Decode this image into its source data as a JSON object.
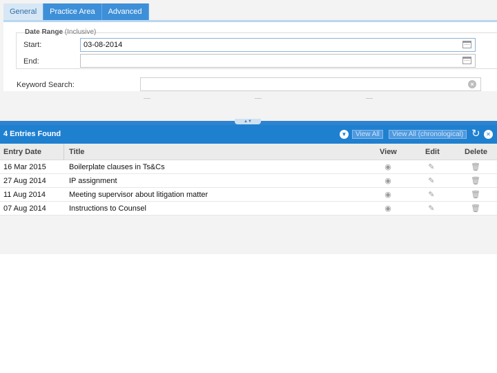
{
  "tabs": [
    {
      "label": "General",
      "active": true
    },
    {
      "label": "Practice Area",
      "active": false
    },
    {
      "label": "Advanced",
      "active": false
    }
  ],
  "date_range": {
    "title": "Date Range",
    "note": "(Inclusive)",
    "start_label": "Start:",
    "start_value": "03-08-2014",
    "end_label": "End:",
    "end_value": ""
  },
  "keyword": {
    "label": "Keyword Search:",
    "value": ""
  },
  "results": {
    "count_text": "4 Entries Found",
    "view_all_label": "View All",
    "view_all_chrono_label": "View All (chronological)"
  },
  "columns": {
    "entry_date": "Entry Date",
    "title": "Title",
    "view": "View",
    "edit": "Edit",
    "delete": "Delete"
  },
  "entries": [
    {
      "date": "16 Mar 2015",
      "title": "Boilerplate clauses in Ts&Cs"
    },
    {
      "date": "27 Aug 2014",
      "title": "IP assignment"
    },
    {
      "date": "11 Aug 2014",
      "title": "Meeting supervisor about litigation matter"
    },
    {
      "date": "07 Aug 2014",
      "title": "Instructions to Counsel"
    }
  ],
  "icons": {
    "calendar": "calendar-icon",
    "clear": "clear-icon",
    "view": "eye-icon",
    "edit": "pencil-icon",
    "delete": "trash-icon",
    "refresh": "refresh-icon",
    "collapse": "chevron-down-icon",
    "close": "close-icon"
  },
  "colors": {
    "accent": "#1f80d0",
    "tab": "#3d8fd8",
    "tab_active_bg": "#d7e7f5"
  }
}
